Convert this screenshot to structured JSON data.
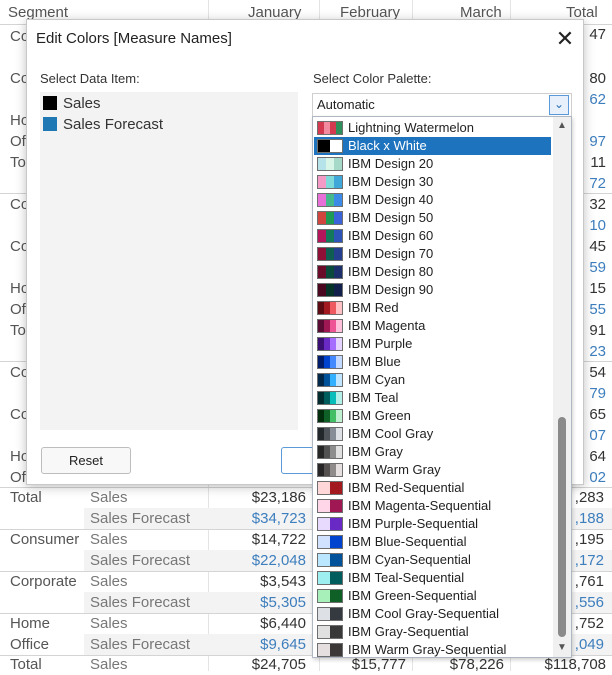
{
  "worksheet": {
    "headers": {
      "segment": "Segment",
      "january": "January",
      "february": "February",
      "march": "March",
      "total": "Total"
    },
    "edge_values": [
      "47",
      "80",
      "62",
      "97",
      "11",
      "72",
      "32",
      "10",
      "45",
      "59",
      "15",
      "55",
      "91",
      "23",
      "54",
      "79",
      "65",
      "07",
      "64",
      "02"
    ],
    "left_fragments": [
      "Co",
      "Co",
      "Ho",
      "Of",
      "To",
      "Co",
      "Co",
      "Ho",
      "Of",
      "To",
      "Co",
      "Co",
      "Ho",
      "Of"
    ],
    "rows": [
      {
        "segment": "Total",
        "measure": "Sales",
        "jan": "$23,186",
        "total": ",283"
      },
      {
        "segment": "",
        "measure": "Sales Forecast",
        "jan": "$34,723",
        "total": ",188"
      },
      {
        "segment": "Consumer",
        "measure": "Sales",
        "jan": "$14,722",
        "total": ",195"
      },
      {
        "segment": "",
        "measure": "Sales Forecast",
        "jan": "$22,048",
        "total": ",172"
      },
      {
        "segment": "Corporate",
        "measure": "Sales",
        "jan": "$3,543",
        "total": ",761"
      },
      {
        "segment": "",
        "measure": "Sales Forecast",
        "jan": "$5,305",
        "total": ",556"
      },
      {
        "segment": "Home",
        "measure": "Sales",
        "jan": "$6,440",
        "total": ",752"
      },
      {
        "segment": "Office",
        "measure": "Sales Forecast",
        "jan": "$9,645",
        "total": ",049"
      },
      {
        "segment": "Total",
        "measure": "Sales",
        "jan": "$24,705",
        "feb": "$15,777",
        "mar": "$78,226",
        "total": "$118,708"
      }
    ]
  },
  "dialog": {
    "title": "Edit Colors [Measure Names]",
    "close_icon": "close-icon",
    "select_item_label": "Select Data Item:",
    "select_palette_label": "Select Color Palette:",
    "items": [
      {
        "label": "Sales",
        "color": "#000000"
      },
      {
        "label": "Sales Forecast",
        "color": "#1f77b4"
      }
    ],
    "reset_label": "Reset",
    "palette_value": "Automatic",
    "palette_options": [
      {
        "label": "Lightning Watermelon",
        "selected": false,
        "colors": [
          "#d43a4f",
          "#f28ba0",
          "#d43a4f",
          "#2f8f5b"
        ]
      },
      {
        "label": "Black x White",
        "selected": true,
        "colors": [
          "#000000",
          "#ffffff"
        ]
      },
      {
        "label": "IBM Design 20",
        "selected": false,
        "colors": [
          "#b6e2ea",
          "#d9f5e8",
          "#a6d9c8"
        ]
      },
      {
        "label": "IBM Design 30",
        "selected": false,
        "colors": [
          "#f39ac6",
          "#7fdbd9",
          "#3fa8d8"
        ]
      },
      {
        "label": "IBM Design 40",
        "selected": false,
        "colors": [
          "#e66fd8",
          "#46b98c",
          "#3b8ae6"
        ]
      },
      {
        "label": "IBM Design 50",
        "selected": false,
        "colors": [
          "#d0463e",
          "#1f9a55",
          "#3a63d9"
        ]
      },
      {
        "label": "IBM Design 60",
        "selected": false,
        "colors": [
          "#b5155a",
          "#14795a",
          "#2d55b8"
        ]
      },
      {
        "label": "IBM Design 70",
        "selected": false,
        "colors": [
          "#8e1036",
          "#0e5f52",
          "#233f8e"
        ]
      },
      {
        "label": "IBM Design 80",
        "selected": false,
        "colors": [
          "#6a0b2a",
          "#0a4a3b",
          "#1b2f6b"
        ]
      },
      {
        "label": "IBM Design 90",
        "selected": false,
        "colors": [
          "#4a0720",
          "#063328",
          "#10204a"
        ]
      },
      {
        "label": "IBM Red",
        "selected": false,
        "colors": [
          "#5a0a10",
          "#a2191f",
          "#ee5a5f",
          "#ffc1c3"
        ]
      },
      {
        "label": "IBM Magenta",
        "selected": false,
        "colors": [
          "#5a0b33",
          "#9f1853",
          "#ee5396",
          "#ffc0dc"
        ]
      },
      {
        "label": "IBM Purple",
        "selected": false,
        "colors": [
          "#3a0f74",
          "#6929c4",
          "#a56eff",
          "#e5d4ff"
        ]
      },
      {
        "label": "IBM Blue",
        "selected": false,
        "colors": [
          "#001d6c",
          "#0043ce",
          "#4589ff",
          "#c4d9ff"
        ]
      },
      {
        "label": "IBM Cyan",
        "selected": false,
        "colors": [
          "#012749",
          "#00539a",
          "#33b1ff",
          "#c0e6ff"
        ]
      },
      {
        "label": "IBM Teal",
        "selected": false,
        "colors": [
          "#022b30",
          "#005d5d",
          "#08bdba",
          "#b4f0ea"
        ]
      },
      {
        "label": "IBM Green",
        "selected": false,
        "colors": [
          "#022d0d",
          "#0e6027",
          "#42be65",
          "#bff0cf"
        ]
      },
      {
        "label": "IBM Cool Gray",
        "selected": false,
        "colors": [
          "#21272a",
          "#4d5358",
          "#878d96",
          "#dde1e6"
        ]
      },
      {
        "label": "IBM Gray",
        "selected": false,
        "colors": [
          "#262626",
          "#525252",
          "#8d8d8d",
          "#e0e0e0"
        ]
      },
      {
        "label": "IBM Warm Gray",
        "selected": false,
        "colors": [
          "#272525",
          "#565151",
          "#8f8b8b",
          "#e5e0df"
        ]
      },
      {
        "label": "IBM Red-Sequential",
        "selected": false,
        "colors": [
          "#ffd7d9",
          "#a2191f"
        ]
      },
      {
        "label": "IBM Magenta-Sequential",
        "selected": false,
        "colors": [
          "#ffd6e8",
          "#9f1853"
        ]
      },
      {
        "label": "IBM Purple-Sequential",
        "selected": false,
        "colors": [
          "#e8daff",
          "#6929c4"
        ]
      },
      {
        "label": "IBM Blue-Sequential",
        "selected": false,
        "colors": [
          "#d0e2ff",
          "#0043ce"
        ]
      },
      {
        "label": "IBM Cyan-Sequential",
        "selected": false,
        "colors": [
          "#bae6ff",
          "#00539a"
        ]
      },
      {
        "label": "IBM Teal-Sequential",
        "selected": false,
        "colors": [
          "#9ef0f0",
          "#005d5d"
        ]
      },
      {
        "label": "IBM Green-Sequential",
        "selected": false,
        "colors": [
          "#a7f0ba",
          "#0e6027"
        ]
      },
      {
        "label": "IBM Cool Gray-Sequential",
        "selected": false,
        "colors": [
          "#dde1e6",
          "#343a3f"
        ]
      },
      {
        "label": "IBM Gray-Sequential",
        "selected": false,
        "colors": [
          "#e0e0e0",
          "#393939"
        ]
      },
      {
        "label": "IBM Warm Gray-Sequential",
        "selected": false,
        "colors": [
          "#e5e0df",
          "#3c3838"
        ]
      }
    ]
  },
  "colors": {
    "accent": "#1e73be",
    "forecast_text": "#3d7ebd"
  }
}
